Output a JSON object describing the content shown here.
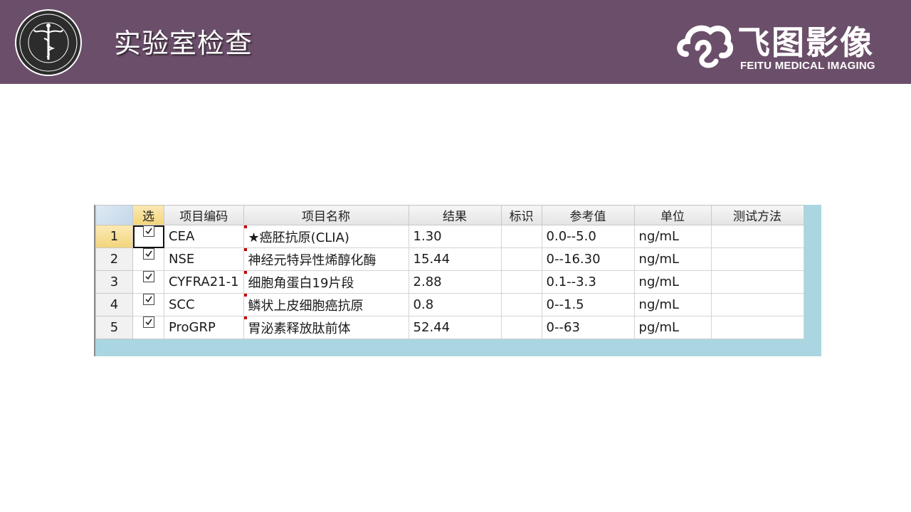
{
  "header": {
    "title": "实验室检查",
    "brand_name": "飞图影像",
    "brand_subtitle": "FEITU MEDICAL IMAGING"
  },
  "colors": {
    "header_bg": "#6b4f6a",
    "grid_panel_bg": "#a9d6e0"
  },
  "grid": {
    "columns": [
      "选",
      "项目编码",
      "项目名称",
      "结果",
      "标识",
      "参考值",
      "单位",
      "测试方法"
    ],
    "rows": [
      {
        "num": "1",
        "checked": true,
        "code": "CEA",
        "name": "★癌胚抗原(CLIA)",
        "result": "1.30",
        "flag": "",
        "reference": "0.0--5.0",
        "unit": "ng/mL",
        "method": ""
      },
      {
        "num": "2",
        "checked": true,
        "code": "NSE",
        "name": "神经元特异性烯醇化酶",
        "result": "15.44",
        "flag": "",
        "reference": "0--16.30",
        "unit": "ng/mL",
        "method": ""
      },
      {
        "num": "3",
        "checked": true,
        "code": "CYFRA21-1",
        "name": "细胞角蛋白19片段",
        "result": "2.88",
        "flag": "",
        "reference": "0.1--3.3",
        "unit": "ng/mL",
        "method": ""
      },
      {
        "num": "4",
        "checked": true,
        "code": "SCC",
        "name": "鳞状上皮细胞癌抗原",
        "result": "0.8",
        "flag": "",
        "reference": "0--1.5",
        "unit": "ng/mL",
        "method": ""
      },
      {
        "num": "5",
        "checked": true,
        "code": "ProGRP",
        "name": "胃泌素释放肽前体",
        "result": "52.44",
        "flag": "",
        "reference": "0--63",
        "unit": "pg/mL",
        "method": ""
      }
    ]
  }
}
